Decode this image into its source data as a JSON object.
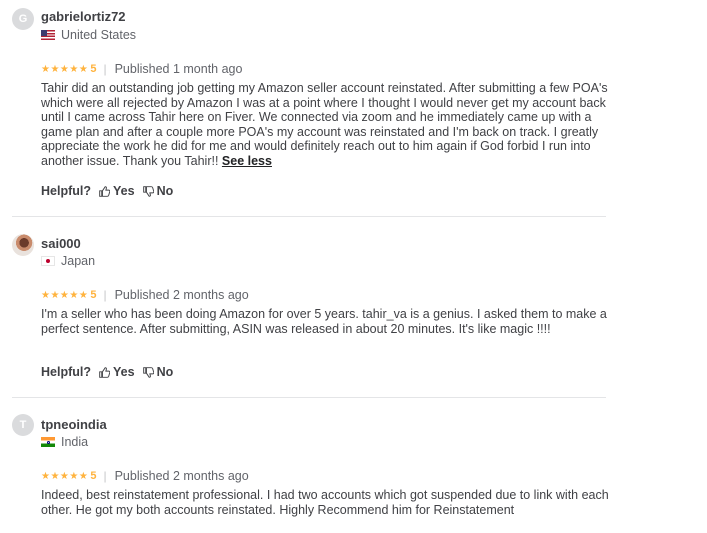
{
  "reviews": [
    {
      "avatar_letter": "G",
      "username": "gabrielortiz72",
      "country": "United States",
      "flag": "us",
      "stars": "★★★★★",
      "score": "5",
      "published": "Published 1 month ago",
      "text": "Tahir did an outstanding job getting my Amazon seller account reinstated. After submitting a few POA's which were all rejected by Amazon I was at a point where I thought I would never get my account back until I came across Tahir here on Fiver. We connected via zoom and he immediately came up with a game plan and after a couple more POA's my account was reinstated and I'm back on track. I greatly appreciate the work he did for me and would definitely reach out to him again if God forbid I run into another issue. Thank you Tahir!!",
      "see_less": "See less",
      "helpful_label": "Helpful?",
      "yes_label": "Yes",
      "no_label": "No"
    },
    {
      "avatar_letter": "",
      "username": "sai000",
      "country": "Japan",
      "flag": "jp",
      "stars": "★★★★★",
      "score": "5",
      "published": "Published 2 months ago",
      "text": "I'm a seller who has been doing Amazon for over 5 years. tahir_va is a genius. I asked them to make a perfect sentence. After submitting, ASIN was released in about 20 minutes. It's like magic !!!!",
      "helpful_label": "Helpful?",
      "yes_label": "Yes",
      "no_label": "No"
    },
    {
      "avatar_letter": "T",
      "username": "tpneoindia",
      "country": "India",
      "flag": "in",
      "stars": "★★★★★",
      "score": "5",
      "published": "Published 2 months ago",
      "text": "Indeed, best reinstatement professional. I had two accounts which got suspended due to link with each other. He got my both accounts reinstated. Highly Recommend him for Reinstatement"
    }
  ]
}
